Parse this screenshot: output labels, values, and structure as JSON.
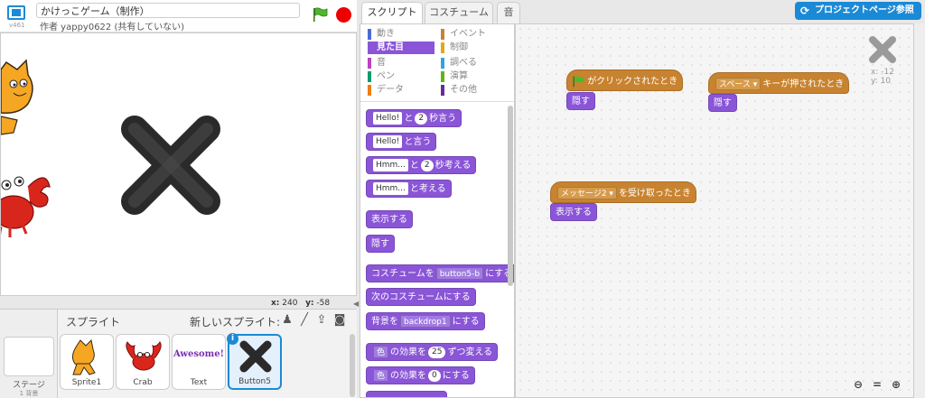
{
  "app": {
    "version": "v461",
    "project_title": "かけっこゲーム（制作）",
    "author": "作者 yappy0622 (共有していない)"
  },
  "stage": {
    "coord_x_label": "x:",
    "coord_x": "240",
    "coord_y_label": "y:",
    "coord_y": "-58"
  },
  "sprites_panel": {
    "title": "スプライト",
    "new_sprite_label": "新しいスプライト:",
    "stage_label": "ステージ",
    "stage_sub": "1 背景",
    "sprites": [
      {
        "name": "Sprite1"
      },
      {
        "name": "Crab"
      },
      {
        "name": "Text",
        "art_text": "Awesome!"
      },
      {
        "name": "Button5",
        "selected": true
      }
    ]
  },
  "tabs": [
    {
      "label": "スクリプト",
      "active": true
    },
    {
      "label": "コスチューム"
    },
    {
      "label": "音"
    }
  ],
  "project_page_button": "プロジェクトページ参照",
  "categories": [
    {
      "label": "動き",
      "color": "#4a6cd4"
    },
    {
      "label": "見た目",
      "color": "#8a55d7",
      "active": true
    },
    {
      "label": "音",
      "color": "#bb42c3"
    },
    {
      "label": "ペン",
      "color": "#0e9a6c"
    },
    {
      "label": "データ",
      "color": "#ee7d16"
    },
    {
      "label": "イベント",
      "color": "#c88330"
    },
    {
      "label": "制御",
      "color": "#e1a91a"
    },
    {
      "label": "調べる",
      "color": "#2ca5e2"
    },
    {
      "label": "演算",
      "color": "#5cb712"
    },
    {
      "label": "その他",
      "color": "#632d99"
    }
  ],
  "palette_blocks": {
    "say_for": {
      "slot": "Hello!",
      "mid": "と",
      "num": "2",
      "tail": "秒言う"
    },
    "say": {
      "slot": "Hello!",
      "tail": "と言う"
    },
    "think_for": {
      "slot": "Hmm...",
      "mid": "と",
      "num": "2",
      "tail": "秒考える"
    },
    "think": {
      "slot": "Hmm...",
      "tail": "と考える"
    },
    "show": "表示する",
    "hide": "隠す",
    "switch_costume": {
      "head": "コスチュームを",
      "value": "button5-b",
      "tail": "にする"
    },
    "next_costume": "次のコスチュームにする",
    "switch_backdrop": {
      "head": "背景を",
      "value": "backdrop1",
      "tail": "にする"
    },
    "change_effect": {
      "effect": "色",
      "mid": "の効果を",
      "num": "25",
      "tail": "ずつ変える"
    },
    "set_effect": {
      "effect": "色",
      "mid": "の効果を",
      "num": "0",
      "tail": "にする"
    }
  },
  "scripts": {
    "flag_hat": "がクリックされたとき",
    "flag_hide": "隠す",
    "key_hat": {
      "key": "スペース",
      "tail": "キーが押されたとき"
    },
    "key_hide": "隠す",
    "msg_hat": {
      "msg": "メッセージ2",
      "tail": "を受け取ったとき"
    },
    "msg_show": "表示する"
  },
  "readout": {
    "x": "x: -12",
    "y": "y: 10"
  },
  "colors": {
    "looks": "#8a55d7",
    "events": "#c88330",
    "accent": "#1b8ad6"
  }
}
